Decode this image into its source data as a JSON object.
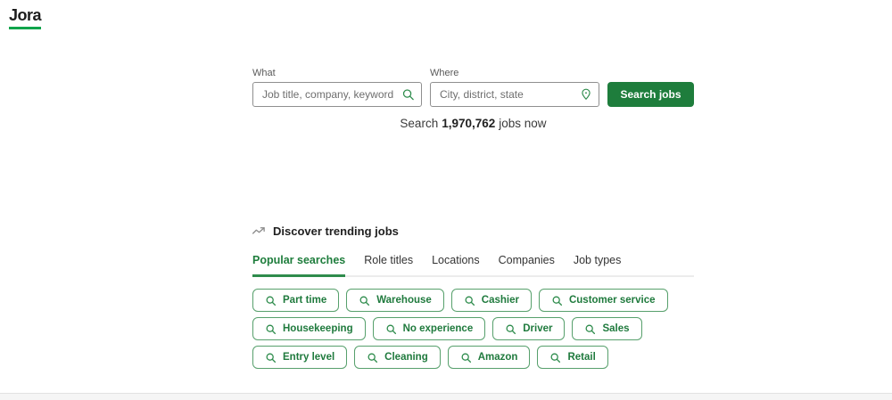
{
  "brand": {
    "logo_text": "Jora"
  },
  "search": {
    "what_label": "What",
    "what_placeholder": "Job title, company, keyword",
    "where_label": "Where",
    "where_placeholder": "City, district, state",
    "button_label": "Search jobs",
    "count_prefix": "Search",
    "count_value": "1,970,762",
    "count_suffix": "jobs now"
  },
  "trending": {
    "heading": "Discover trending jobs",
    "tabs": [
      {
        "label": "Popular searches",
        "active": true
      },
      {
        "label": "Role titles",
        "active": false
      },
      {
        "label": "Locations",
        "active": false
      },
      {
        "label": "Companies",
        "active": false
      },
      {
        "label": "Job types",
        "active": false
      }
    ],
    "pills": [
      "Part time",
      "Warehouse",
      "Cashier",
      "Customer service",
      "Housekeeping",
      "No experience",
      "Driver",
      "Sales",
      "Entry level",
      "Cleaning",
      "Amazon",
      "Retail"
    ]
  },
  "colors": {
    "brand_green": "#1e7d3c",
    "logo_underline_green": "#10a44b",
    "pill_border_green": "#57a06c",
    "footer_bg": "#f5f5f5"
  }
}
